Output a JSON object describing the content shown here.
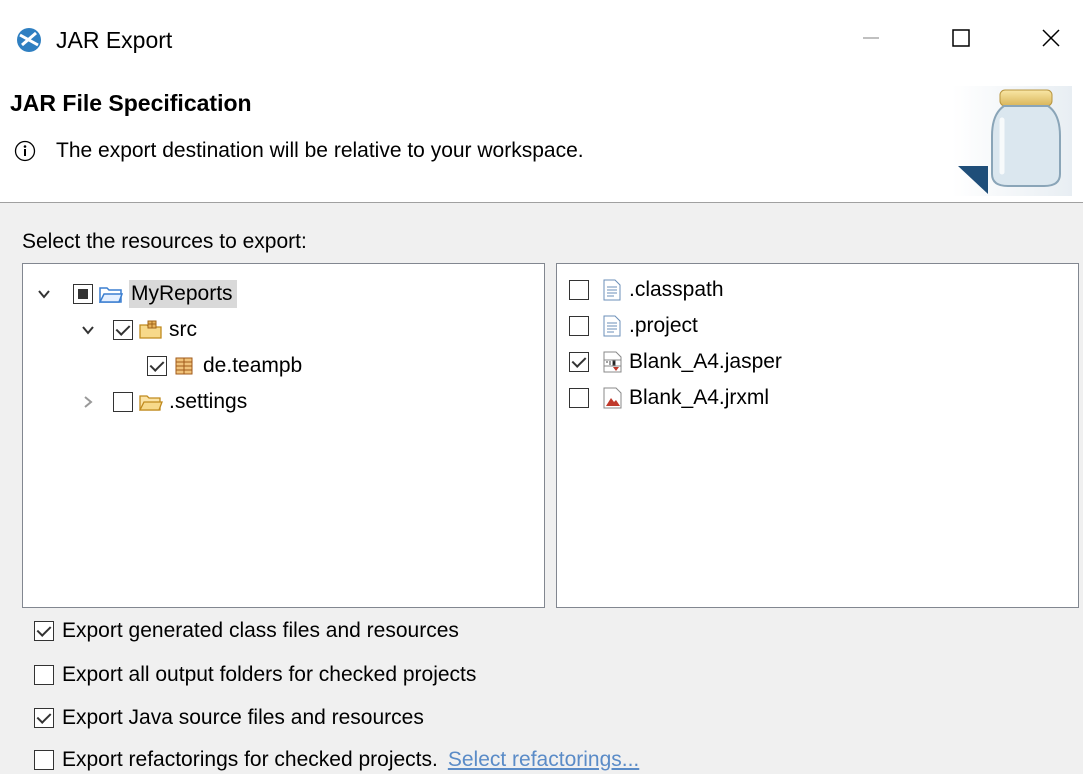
{
  "window": {
    "title": "JAR Export",
    "icons": {
      "app": "jar-export-app-icon",
      "min": "minimize-icon",
      "max": "maximize-icon",
      "close": "close-icon"
    }
  },
  "header": {
    "title": "JAR File Specification",
    "info_text": "The export destination will be relative to your workspace.",
    "banner_icon": "jar-banner-icon"
  },
  "resources": {
    "label": "Select the resources to export:",
    "tree": [
      {
        "label": "MyReports",
        "state": "partial",
        "expanded": true,
        "icon": "project-folder-icon",
        "selected": true
      },
      {
        "label": "src",
        "state": "checked",
        "expanded": true,
        "icon": "source-folder-icon"
      },
      {
        "label": "de.teampb",
        "state": "checked",
        "icon": "package-icon"
      },
      {
        "label": ".settings",
        "state": "unchecked",
        "expanded": false,
        "icon": "folder-icon"
      }
    ],
    "files": [
      {
        "label": ".classpath",
        "state": "unchecked",
        "icon": "text-file-icon"
      },
      {
        "label": ".project",
        "state": "unchecked",
        "icon": "text-file-icon"
      },
      {
        "label": "Blank_A4.jasper",
        "state": "checked",
        "icon": "jasper-file-icon"
      },
      {
        "label": "Blank_A4.jrxml",
        "state": "unchecked",
        "icon": "jrxml-file-icon"
      }
    ]
  },
  "options": [
    {
      "label": "Export generated class files and resources",
      "checked": true
    },
    {
      "label": "Export all output folders for checked projects",
      "checked": false
    },
    {
      "label": "Export Java source files and resources",
      "checked": true
    },
    {
      "label": "Export refactorings for checked projects.",
      "checked": false,
      "link": "Select refactorings..."
    }
  ],
  "colors": {
    "link": "#5a8bc7",
    "body_bg": "#f0f0f0",
    "selection": "#d9d9d9"
  }
}
